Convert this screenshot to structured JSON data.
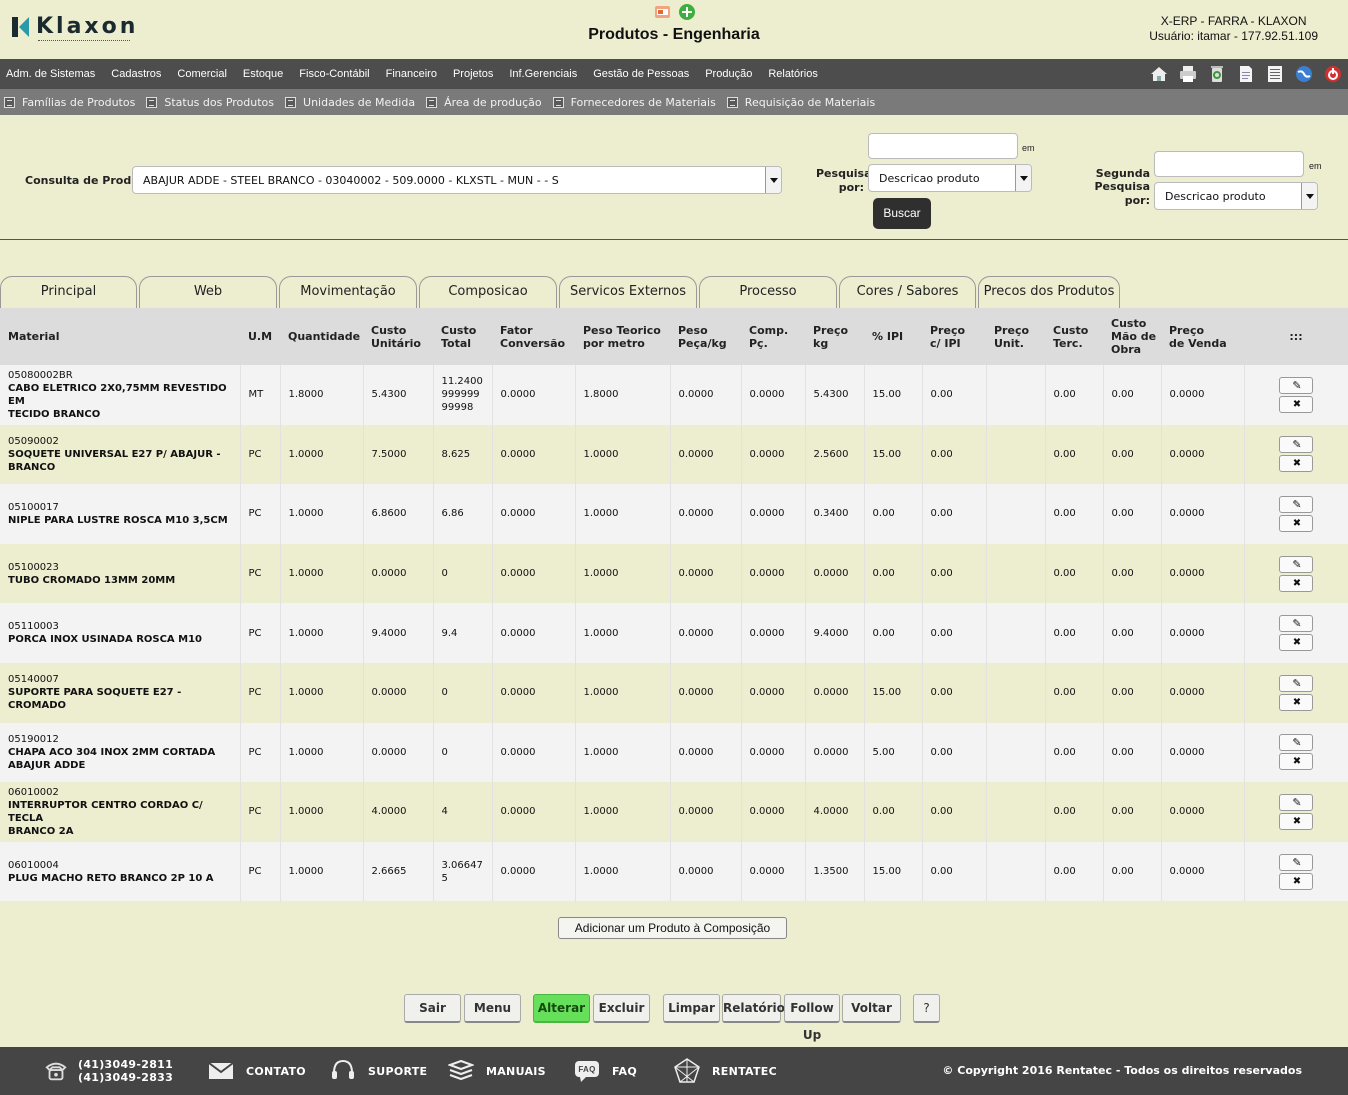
{
  "header": {
    "logo_text": "Klaxon",
    "title": "Produtos - Engenharia",
    "system": "X-ERP - FARRA - KLAXON",
    "user": "Usuário: itamar - 177.92.51.109"
  },
  "menu": {
    "items": [
      "Adm. de Sistemas",
      "Cadastros",
      "Comercial",
      "Estoque",
      "Fisco-Contábil",
      "Financeiro",
      "Projetos",
      "Inf.Gerenciais",
      "Gestão de Pessoas",
      "Produção",
      "Relatórios"
    ],
    "tools": [
      "home-icon",
      "print-icon",
      "recycle-icon",
      "document-icon",
      "list-icon",
      "globe-icon",
      "power-icon"
    ]
  },
  "submenu": {
    "items": [
      "Famílias de Produtos",
      "Status dos Produtos",
      "Unidades de Medida",
      "Área de produção",
      "Fornecedores de Materiais",
      "Requisição de Materiais"
    ]
  },
  "search": {
    "consulta_label": "Consulta de Produtos",
    "consulta_value": "ABAJUR ADDE - STEEL BRANCO - 03040002 - 509.0000 - KLXSTL - MUN - - S",
    "pesquisar_label_1": "Pesquisar",
    "pesquisar_label_2": "por:",
    "pesquisar_select": "Descricao produto",
    "segunda_label_1": "Segunda Pesquisa",
    "segunda_label_2": "por:",
    "segunda_select": "Descricao produto",
    "em": "em",
    "buscar": "Buscar"
  },
  "tabs": [
    "Principal",
    "Web",
    "Movimentação",
    "Composicao",
    "Servicos Externos",
    "Processo",
    "Cores / Sabores",
    "Precos dos Produtos"
  ],
  "table": {
    "headers": {
      "material": "Material",
      "um": "U.M",
      "quantidade": "Quantidade",
      "custo_unit_1": "Custo",
      "custo_unit_2": "Unitário",
      "custo_total_1": "Custo",
      "custo_total_2": "Total",
      "fator_1": "Fator",
      "fator_2": "Conversão",
      "peso_teorico_1": "Peso Teorico",
      "peso_teorico_2": "por metro",
      "peso_peca_1": "Peso",
      "peso_peca_2": "Peça/kg",
      "comp_1": "Comp.",
      "comp_2": "Pç.",
      "preco_kg_1": "Preço",
      "preco_kg_2": "kg",
      "ipi": "% IPI",
      "preco_ipi_1": "Preço",
      "preco_ipi_2": "c/ IPI",
      "preco_unit_1": "Preço",
      "preco_unit_2": "Unit.",
      "custo_terc_1": "Custo",
      "custo_terc_2": "Terc.",
      "custo_mo_1": "Custo",
      "custo_mo_2": "Mão de",
      "custo_mo_3": "Obra",
      "preco_venda_1": "Preço",
      "preco_venda_2": "de Venda",
      "actions": ":::"
    },
    "rows": [
      {
        "code": "05080002BR",
        "desc_1": "CABO ELETRICO 2X0,75MM REVESTIDO EM",
        "desc_2": "TECIDO BRANCO",
        "um": "MT",
        "qtd": "1.8000",
        "custo_unit": "5.4300",
        "custo_total_1": "11.2400",
        "custo_total_2": "999999",
        "custo_total_3": "99998",
        "fator": "0.0000",
        "peso_teorico": "1.8000",
        "peso_peca": "0.0000",
        "comp": "0.0000",
        "preco_kg": "5.4300",
        "ipi": "15.00",
        "preco_ipi": "0.00",
        "preco_unit": "",
        "custo_terc": "0.00",
        "custo_mo": "0.00",
        "preco_venda": "0.0000"
      },
      {
        "code": "05090002",
        "desc_1": "SOQUETE UNIVERSAL E27 P/ ABAJUR -",
        "desc_2": "BRANCO",
        "um": "PC",
        "qtd": "1.0000",
        "custo_unit": "7.5000",
        "custo_total_1": "8.625",
        "custo_total_2": "",
        "custo_total_3": "",
        "fator": "0.0000",
        "peso_teorico": "1.0000",
        "peso_peca": "0.0000",
        "comp": "0.0000",
        "preco_kg": "2.5600",
        "ipi": "15.00",
        "preco_ipi": "0.00",
        "preco_unit": "",
        "custo_terc": "0.00",
        "custo_mo": "0.00",
        "preco_venda": "0.0000"
      },
      {
        "code": "05100017",
        "desc_1": "NIPLE PARA LUSTRE ROSCA M10 3,5CM",
        "desc_2": "",
        "um": "PC",
        "qtd": "1.0000",
        "custo_unit": "6.8600",
        "custo_total_1": "6.86",
        "custo_total_2": "",
        "custo_total_3": "",
        "fator": "0.0000",
        "peso_teorico": "1.0000",
        "peso_peca": "0.0000",
        "comp": "0.0000",
        "preco_kg": "0.3400",
        "ipi": "0.00",
        "preco_ipi": "0.00",
        "preco_unit": "",
        "custo_terc": "0.00",
        "custo_mo": "0.00",
        "preco_venda": "0.0000"
      },
      {
        "code": "05100023",
        "desc_1": "TUBO CROMADO 13MM 20MM",
        "desc_2": "",
        "um": "PC",
        "qtd": "1.0000",
        "custo_unit": "0.0000",
        "custo_total_1": "0",
        "custo_total_2": "",
        "custo_total_3": "",
        "fator": "0.0000",
        "peso_teorico": "1.0000",
        "peso_peca": "0.0000",
        "comp": "0.0000",
        "preco_kg": "0.0000",
        "ipi": "0.00",
        "preco_ipi": "0.00",
        "preco_unit": "",
        "custo_terc": "0.00",
        "custo_mo": "0.00",
        "preco_venda": "0.0000"
      },
      {
        "code": "05110003",
        "desc_1": "PORCA INOX USINADA ROSCA M10",
        "desc_2": "",
        "um": "PC",
        "qtd": "1.0000",
        "custo_unit": "9.4000",
        "custo_total_1": "9.4",
        "custo_total_2": "",
        "custo_total_3": "",
        "fator": "0.0000",
        "peso_teorico": "1.0000",
        "peso_peca": "0.0000",
        "comp": "0.0000",
        "preco_kg": "9.4000",
        "ipi": "0.00",
        "preco_ipi": "0.00",
        "preco_unit": "",
        "custo_terc": "0.00",
        "custo_mo": "0.00",
        "preco_venda": "0.0000"
      },
      {
        "code": "05140007",
        "desc_1": "SUPORTE PARA SOQUETE E27 - CROMADO",
        "desc_2": "",
        "um": "PC",
        "qtd": "1.0000",
        "custo_unit": "0.0000",
        "custo_total_1": "0",
        "custo_total_2": "",
        "custo_total_3": "",
        "fator": "0.0000",
        "peso_teorico": "1.0000",
        "peso_peca": "0.0000",
        "comp": "0.0000",
        "preco_kg": "0.0000",
        "ipi": "15.00",
        "preco_ipi": "0.00",
        "preco_unit": "",
        "custo_terc": "0.00",
        "custo_mo": "0.00",
        "preco_venda": "0.0000"
      },
      {
        "code": "05190012",
        "desc_1": "CHAPA ACO 304 INOX 2MM CORTADA",
        "desc_2": "ABAJUR ADDE",
        "um": "PC",
        "qtd": "1.0000",
        "custo_unit": "0.0000",
        "custo_total_1": "0",
        "custo_total_2": "",
        "custo_total_3": "",
        "fator": "0.0000",
        "peso_teorico": "1.0000",
        "peso_peca": "0.0000",
        "comp": "0.0000",
        "preco_kg": "0.0000",
        "ipi": "5.00",
        "preco_ipi": "0.00",
        "preco_unit": "",
        "custo_terc": "0.00",
        "custo_mo": "0.00",
        "preco_venda": "0.0000"
      },
      {
        "code": "06010002",
        "desc_1": "INTERRUPTOR CENTRO CORDAO C/ TECLA",
        "desc_2": "BRANCO 2A",
        "um": "PC",
        "qtd": "1.0000",
        "custo_unit": "4.0000",
        "custo_total_1": "4",
        "custo_total_2": "",
        "custo_total_3": "",
        "fator": "0.0000",
        "peso_teorico": "1.0000",
        "peso_peca": "0.0000",
        "comp": "0.0000",
        "preco_kg": "4.0000",
        "ipi": "0.00",
        "preco_ipi": "0.00",
        "preco_unit": "",
        "custo_terc": "0.00",
        "custo_mo": "0.00",
        "preco_venda": "0.0000"
      },
      {
        "code": "06010004",
        "desc_1": "PLUG MACHO RETO BRANCO 2P 10 A",
        "desc_2": "",
        "um": "PC",
        "qtd": "1.0000",
        "custo_unit": "2.6665",
        "custo_total_1": "3.06647",
        "custo_total_2": "5",
        "custo_total_3": "",
        "fator": "0.0000",
        "peso_teorico": "1.0000",
        "peso_peca": "0.0000",
        "comp": "0.0000",
        "preco_kg": "1.3500",
        "ipi": "15.00",
        "preco_ipi": "0.00",
        "preco_unit": "",
        "custo_terc": "0.00",
        "custo_mo": "0.00",
        "preco_venda": "0.0000"
      }
    ]
  },
  "add_button": "Adicionar um Produto à Composição",
  "actions": [
    "Sair",
    "Menu",
    "Alterar",
    "Excluir",
    "Limpar",
    "Relatório",
    "Follow Up",
    "Voltar",
    "?"
  ],
  "footer": {
    "phone_1": "(41)3049-2811",
    "phone_2": "(41)3049-2833",
    "contato": "CONTATO",
    "suporte": "SUPORTE",
    "manuais": "MANUAIS",
    "faq": "FAQ",
    "faq_icon_text": "FAQ",
    "rentatec": "RENTATEC",
    "copyright": "© Copyright 2016 Rentatec - Todos os direitos reservados"
  },
  "colors": {
    "background": "#ededd0",
    "menubar": "#4d4d4d",
    "submenu": "#7a7a7a",
    "accent_green": "#66e05a",
    "footer": "#454545"
  }
}
